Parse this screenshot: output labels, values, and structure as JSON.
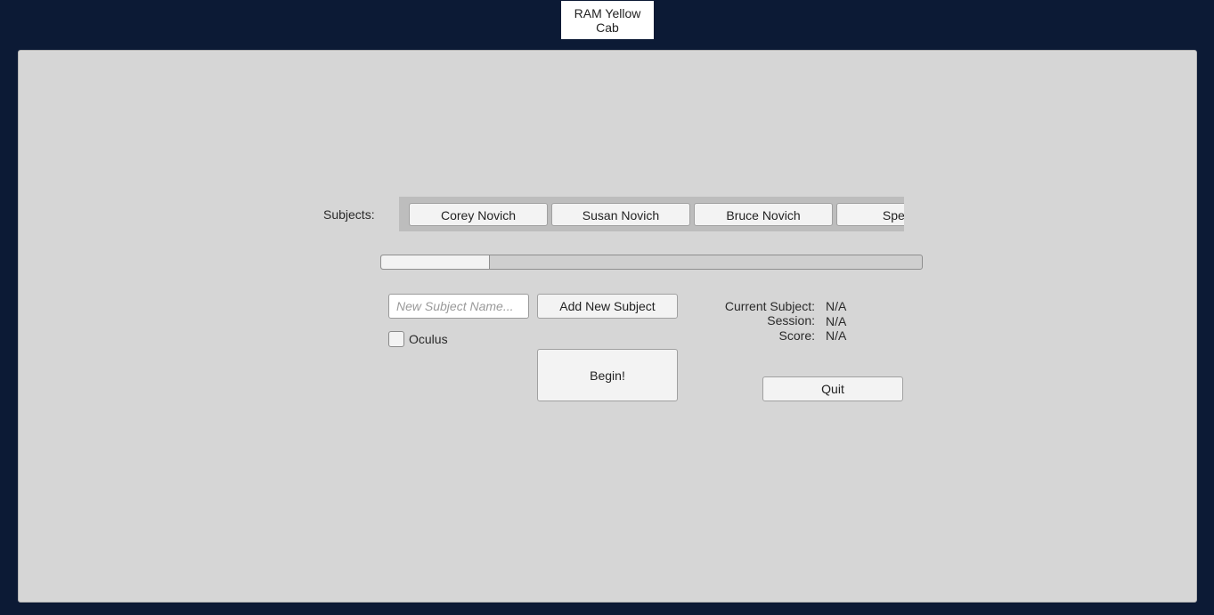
{
  "app": {
    "title": "RAM Yellow\nCab"
  },
  "subjects": {
    "label": "Subjects:",
    "items": [
      "Corey Novich",
      "Susan Novich",
      "Bruce Novich",
      "Spencer"
    ]
  },
  "new_subject": {
    "placeholder": "New Subject Name...",
    "add_label": "Add New Subject"
  },
  "oculus": {
    "label": "Oculus",
    "checked": false
  },
  "begin_label": "Begin!",
  "quit_label": "Quit",
  "info": {
    "current_subject_label": "Current Subject:",
    "current_subject_value": "N/A",
    "session_label": "Session:",
    "session_value": "N/A",
    "score_label": "Score:",
    "score_value": "N/A"
  }
}
